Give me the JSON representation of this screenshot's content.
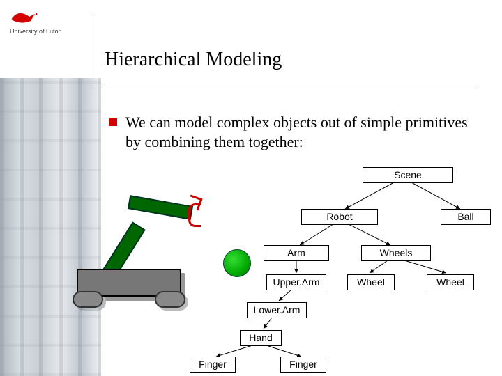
{
  "logo_text": "University of Luton",
  "title": "Hierarchical Modeling",
  "bullet": "We can model complex objects out of simple primitives by combining them together:",
  "tree": {
    "scene": "Scene",
    "robot": "Robot",
    "ball": "Ball",
    "arm": "Arm",
    "wheels": "Wheels",
    "upper_arm": "Upper.Arm",
    "wheel_l": "Wheel",
    "wheel_r": "Wheel",
    "lower_arm": "Lower.Arm",
    "hand": "Hand",
    "finger_l": "Finger",
    "finger_r": "Finger"
  }
}
